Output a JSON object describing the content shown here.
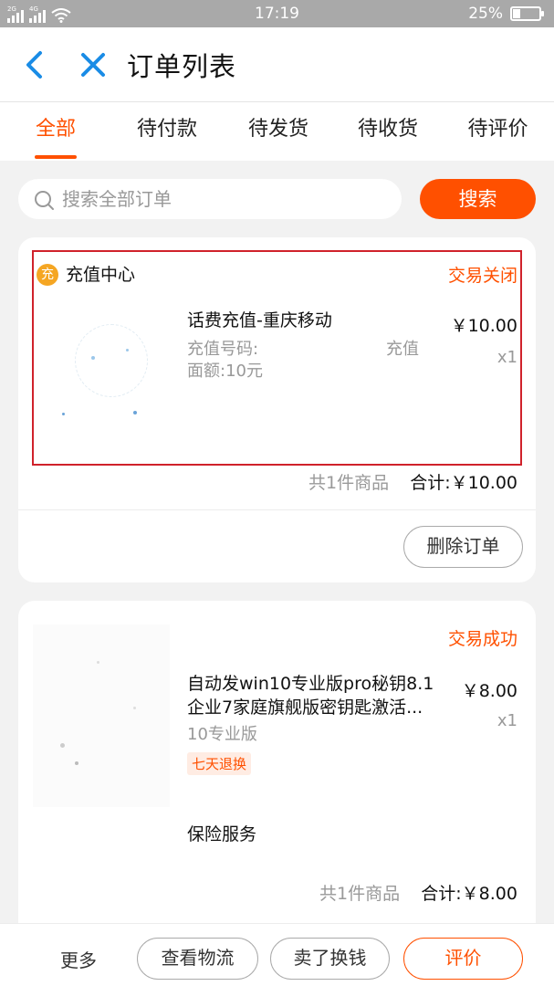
{
  "status_bar": {
    "left_signal_1": "2G",
    "left_signal_2": "4G",
    "time": "17:19",
    "battery": "25%",
    "battery_fraction": 0.25,
    "icons": [
      "signal-icon",
      "wifi-icon",
      "battery-icon"
    ]
  },
  "header": {
    "title": "订单列表",
    "icons": [
      "back-arrow-icon",
      "close-icon"
    ]
  },
  "tabs": [
    {
      "label": "全部",
      "active": true
    },
    {
      "label": "待付款",
      "active": false
    },
    {
      "label": "待发货",
      "active": false
    },
    {
      "label": "待收货",
      "active": false
    },
    {
      "label": "待评价",
      "active": false
    }
  ],
  "search": {
    "placeholder": "搜索全部订单",
    "button_label": "搜索"
  },
  "orders": [
    {
      "shop_icon_char": "充",
      "shop_name": "充值中心",
      "status": "交易关闭",
      "product_name": "话费充值-重庆移动",
      "spec_line1_a": "充值号码:",
      "spec_line1_b": "充值",
      "spec_line2": "面额:10元",
      "price": "￥10.00",
      "qty": "x1",
      "count": "共1件商品",
      "total": "合计:￥10.00",
      "action": "删除订单"
    },
    {
      "status": "交易成功",
      "product_name_line1": "自动发win10专业版pro秘钥8.1",
      "product_name_line2": "企业7家庭旗舰版密钥匙激活...",
      "spec": "10专业版",
      "tag": "七天退换",
      "service": "保险服务",
      "price": "￥8.00",
      "qty": "x1",
      "count": "共1件商品",
      "total": "合计:￥8.00"
    }
  ],
  "bottom_actions": {
    "more": "更多",
    "logistics": "查看物流",
    "resell": "卖了换钱",
    "review": "评价"
  },
  "colors": {
    "accent": "#ff5000",
    "highlight_border": "#d0222b",
    "status_bar": "#a9a9a9",
    "back_icon": "#1a8ce6"
  }
}
